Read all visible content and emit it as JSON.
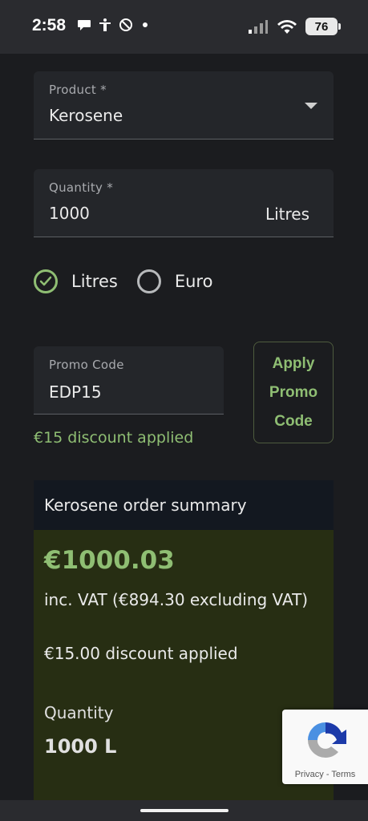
{
  "status_bar": {
    "time": "2:58",
    "battery": "76",
    "icons": [
      "chat-bubble-icon",
      "accessibility-icon",
      "no-sync-icon",
      "dot-icon",
      "signal-icon",
      "wifi-icon",
      "battery-icon"
    ]
  },
  "form": {
    "product": {
      "label": "Product *",
      "value": "Kerosene"
    },
    "quantity": {
      "label": "Quantity *",
      "value": "1000",
      "unit": "Litres"
    },
    "unit_options": [
      {
        "label": "Litres",
        "selected": true
      },
      {
        "label": "Euro",
        "selected": false
      }
    ],
    "promo": {
      "label": "Promo Code",
      "value": "EDP15",
      "apply_button": "Apply Promo Code",
      "status": "€15 discount applied"
    }
  },
  "summary": {
    "title": "Kerosene order summary",
    "price": "€1000.03",
    "vat_note": "inc. VAT (€894.30 excluding VAT)",
    "discount": "€15.00 discount applied",
    "quantity_label": "Quantity",
    "quantity_value": "1000 L"
  },
  "recaptcha": {
    "privacy": "Privacy",
    "separator": " - ",
    "terms": "Terms"
  },
  "colors": {
    "accent": "#8fbe73",
    "background": "#1b1c1f",
    "field_bg": "#24262a",
    "summary_head_bg": "#131820",
    "summary_body_bg": "#272e13"
  }
}
